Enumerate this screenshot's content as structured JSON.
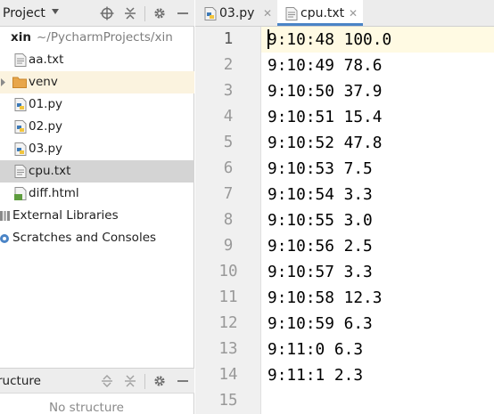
{
  "project_panel": {
    "title": "Project",
    "root": {
      "name": "xin",
      "path": "~/PycharmProjects/xin"
    },
    "items": [
      {
        "label": "aa.txt"
      },
      {
        "label": "venv"
      },
      {
        "label": "01.py"
      },
      {
        "label": "02.py"
      },
      {
        "label": "03.py"
      },
      {
        "label": "cpu.txt"
      },
      {
        "label": "diff.html"
      }
    ],
    "external_libraries": "External Libraries",
    "scratches": "Scratches and Consoles"
  },
  "structure_panel": {
    "title": "ructure",
    "empty_text": "No structure"
  },
  "tabs": [
    {
      "label": "03.py",
      "active": false
    },
    {
      "label": "cpu.txt",
      "active": true
    }
  ],
  "editor": {
    "line_numbers": [
      "1",
      "2",
      "3",
      "4",
      "5",
      "6",
      "7",
      "8",
      "9",
      "10",
      "11",
      "12",
      "13",
      "14",
      "15"
    ],
    "lines": [
      "9:10:48 100.0",
      "9:10:49 78.6",
      "9:10:50 37.9",
      "9:10:51 15.4",
      "9:10:52 47.8",
      "9:10:53 7.5",
      "9:10:54 3.3",
      "9:10:55 3.0",
      "9:10:56 2.5",
      "9:10:57 3.3",
      "9:10:58 12.3",
      "9:10:59 6.3",
      "9:11:0 6.3",
      "9:11:1 2.3",
      ""
    ]
  },
  "colors": {
    "selection": "#d4d4d4",
    "current_line": "#fffae3",
    "tab_underline": "#4a84c6",
    "folder": "#e8a64a"
  }
}
